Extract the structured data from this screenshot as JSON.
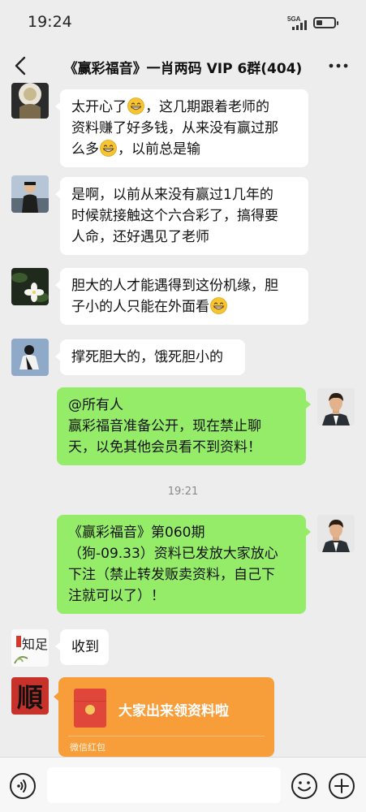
{
  "status_bar": {
    "time": "19:24",
    "network": "5GA"
  },
  "header": {
    "title": "《赢彩福音》一肖两码 VIP 6群(404)"
  },
  "messages": [
    {
      "sender": "other",
      "lines": [
        "太开心了[grin]，这几期跟着老师的",
        "资料赚了好多钱，从来没有赢过那",
        "么多[grin]，以前总是输"
      ]
    },
    {
      "sender": "other",
      "lines": [
        "是啊，以前从来没有赢过1几年的",
        "时候就接触这个六合彩了，搞得要",
        "人命，还好遇见了老师"
      ]
    },
    {
      "sender": "other",
      "lines": [
        "胆大的人才能遇得到这份机缘，胆",
        "子小的人只能在外面看[grin]"
      ]
    },
    {
      "sender": "other",
      "lines": [
        "撑死胆大的，饿死胆小的"
      ]
    },
    {
      "sender": "self",
      "lines": [
        "@所有人",
        "赢彩福音准备公开，现在禁止聊",
        "天，以免其他会员看不到资料！"
      ]
    },
    {
      "sender": "self",
      "lines": [
        "《赢彩福音》第060期",
        "（狗-09.33）资料已发放大家放心",
        "下注（禁止转发贩卖资料，自己下",
        "注就可以了）！"
      ]
    },
    {
      "sender": "other",
      "lines": [
        "收到"
      ]
    }
  ],
  "timestamp": "19:21",
  "avatar_texts": {
    "calligraphy": "知足",
    "shun": "順"
  },
  "red_packet": {
    "title": "大家出来领资料啦",
    "label": "微信红包"
  },
  "colors": {
    "background": "#ededed",
    "incoming_bubble": "#ffffff",
    "outgoing_bubble": "#95ec69",
    "red_packet": "#f79e3b"
  },
  "icons": [
    "back-arrow-icon",
    "more-icon",
    "voice-icon",
    "emoji-icon",
    "plus-icon",
    "grin-emoji-icon"
  ]
}
